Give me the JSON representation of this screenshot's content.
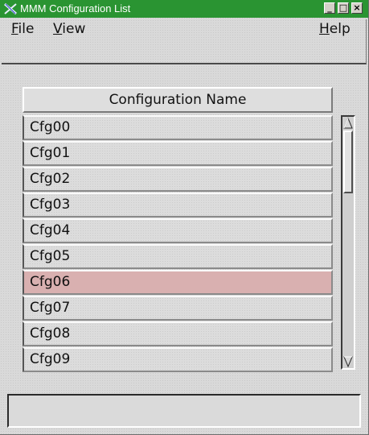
{
  "window": {
    "title": "MMM Configuration List",
    "accent_color": "#2a9432",
    "controls": {
      "minimize_label": "_",
      "maximize_label": "□",
      "close_label": "×"
    }
  },
  "menu": {
    "file": {
      "mnemonic": "F",
      "rest": "ile"
    },
    "view": {
      "mnemonic": "V",
      "rest": "iew"
    },
    "help": {
      "mnemonic": "H",
      "rest": "elp"
    }
  },
  "list": {
    "column_header": "Configuration Name",
    "selected_index": 6,
    "selected_color": "#d9b0b0",
    "rows": [
      {
        "name": "Cfg00"
      },
      {
        "name": "Cfg01"
      },
      {
        "name": "Cfg02"
      },
      {
        "name": "Cfg03"
      },
      {
        "name": "Cfg04"
      },
      {
        "name": "Cfg05"
      },
      {
        "name": "Cfg06"
      },
      {
        "name": "Cfg07"
      },
      {
        "name": "Cfg08"
      },
      {
        "name": "Cfg09"
      }
    ]
  },
  "scrollbar": {
    "up_icon": "triangle-up-icon",
    "down_icon": "triangle-down-icon"
  },
  "status": {
    "text": ""
  }
}
